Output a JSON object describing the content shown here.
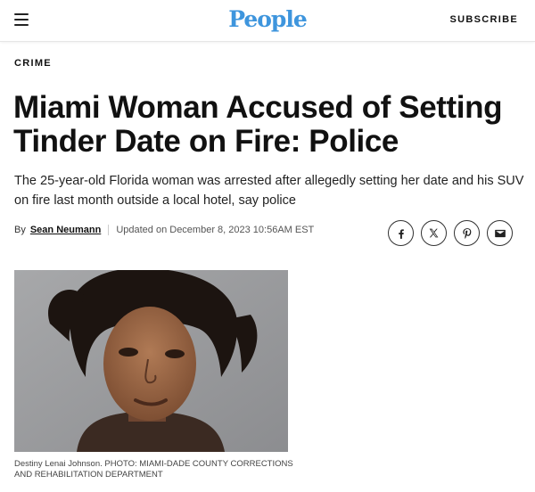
{
  "header": {
    "menu_icon": "hamburger-menu-icon",
    "logo_text": "People",
    "subscribe_label": "SUBSCRIBE",
    "brand_color": "#3e95dd"
  },
  "article": {
    "category": "CRIME",
    "headline": "Miami Woman Accused of Setting Tinder Date on Fire: Police",
    "dek": "The 25-year-old Florida woman was arrested after allegedly setting her date and his SUV on fire last month outside a local hotel, say police",
    "byline": {
      "by_label": "By",
      "author": "Sean Neumann",
      "updated": "Updated on December 8, 2023 10:56AM EST"
    },
    "share_icons": [
      "facebook-icon",
      "x-twitter-icon",
      "pinterest-icon",
      "email-icon"
    ],
    "image": {
      "caption_name": "Destiny Lenai Johnson.",
      "caption_credit": "PHOTO: MIAMI-DADE COUNTY CORRECTIONS AND REHABILITATION DEPARTMENT"
    }
  }
}
